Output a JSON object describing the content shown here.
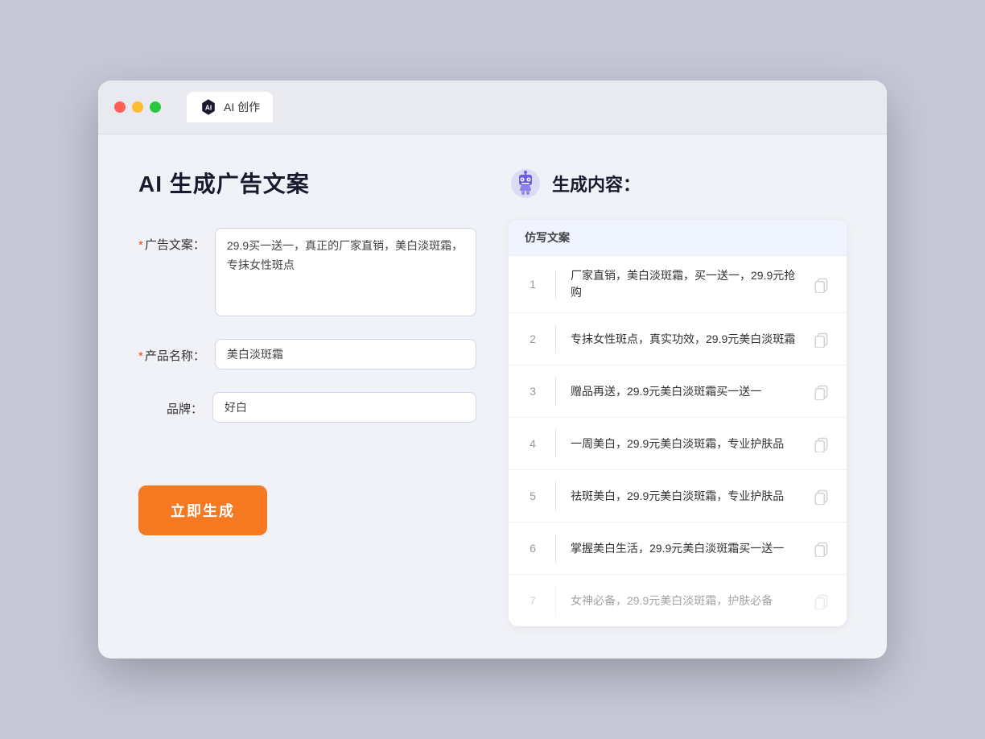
{
  "browser": {
    "tab_label": "AI 创作"
  },
  "page": {
    "title": "AI 生成广告文案",
    "right_title": "生成内容："
  },
  "form": {
    "ad_copy_label": "广告文案：",
    "ad_copy_value": "29.9买一送一，真正的厂家直销，美白淡斑霜，专抹女性斑点",
    "product_name_label": "产品名称：",
    "product_name_value": "美白淡斑霜",
    "brand_label": "品牌：",
    "brand_value": "好白",
    "generate_btn": "立即生成",
    "required_symbol": "*"
  },
  "results": {
    "column_header": "仿写文案",
    "items": [
      {
        "num": "1",
        "text": "厂家直销，美白淡斑霜，买一送一，29.9元抢购",
        "dimmed": false
      },
      {
        "num": "2",
        "text": "专抹女性斑点，真实功效，29.9元美白淡斑霜",
        "dimmed": false
      },
      {
        "num": "3",
        "text": "赠品再送，29.9元美白淡斑霜买一送一",
        "dimmed": false
      },
      {
        "num": "4",
        "text": "一周美白，29.9元美白淡斑霜，专业护肤品",
        "dimmed": false
      },
      {
        "num": "5",
        "text": "祛斑美白，29.9元美白淡斑霜，专业护肤品",
        "dimmed": false
      },
      {
        "num": "6",
        "text": "掌握美白生活，29.9元美白淡斑霜买一送一",
        "dimmed": false
      },
      {
        "num": "7",
        "text": "女神必备，29.9元美白淡斑霜，护肤必备",
        "dimmed": true
      }
    ]
  }
}
